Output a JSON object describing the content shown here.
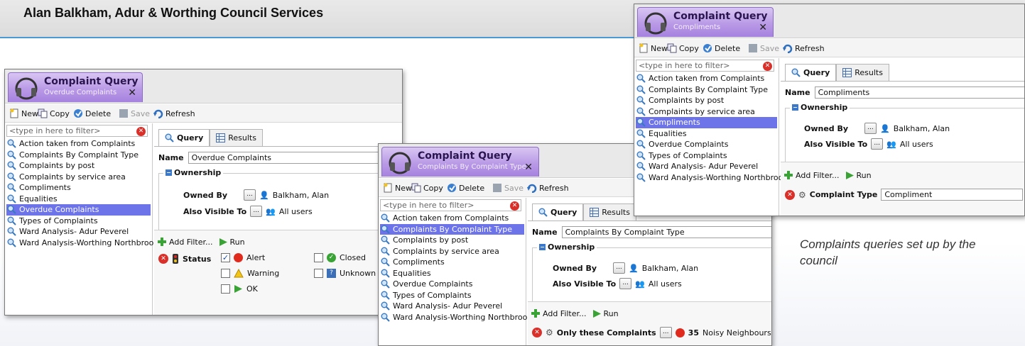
{
  "slide": {
    "title": "Alan Balkham, Adur & Worthing Council Services",
    "caption": "Complaints queries  set up by the council"
  },
  "app": {
    "name": "Complaint Query"
  },
  "toolbar": {
    "new": "New",
    "copy": "Copy",
    "delete": "Delete",
    "save": "Save",
    "refresh": "Refresh"
  },
  "filter_placeholder": "<type in here to filter>",
  "tabs": {
    "query": "Query",
    "results": "Results"
  },
  "labels": {
    "name": "Name",
    "ownership": "Ownership",
    "owned_by": "Owned By",
    "also_visible_to": "Also Visible To",
    "owner_value": "Balkham, Alan",
    "visible_value": "All users",
    "add_filter": "Add Filter...",
    "run": "Run",
    "dots": "..."
  },
  "queries": [
    "Action taken from Complaints",
    "Complaints By Complaint Type",
    "Complaints by post",
    "Complaints by service area",
    "Compliments",
    "Equalities",
    "Overdue Complaints",
    "Types of Complaints",
    "Ward Analysis- Adur Peverel",
    "Ward Analysis-Worthing Northbrook"
  ],
  "windows": {
    "overdue": {
      "subtitle": "Overdue Complaints",
      "name_value": "Overdue Complaints",
      "condition": {
        "field": "Status",
        "options": [
          {
            "label": "Alert",
            "checked": true,
            "color": "#e02a1e"
          },
          {
            "label": "Closed",
            "checked": false,
            "color": "#3aa335"
          },
          {
            "label": "Warning",
            "checked": false,
            "color": "#f2c518"
          },
          {
            "label": "Unknown",
            "checked": false,
            "color": "#3b6fb8"
          },
          {
            "label": "OK",
            "checked": false,
            "color": "#3aa335"
          }
        ]
      }
    },
    "bytype": {
      "subtitle": "Complaints By Complaint Type",
      "name_value": "Complaints By Complaint Type",
      "condition": {
        "field": "Only these Complaints",
        "count": "35",
        "value": "Noisy Neighbours"
      }
    },
    "compliments": {
      "subtitle": "Compliments",
      "name_value": "Compliments",
      "condition": {
        "field": "Complaint Type",
        "value": "Compliment"
      }
    }
  }
}
